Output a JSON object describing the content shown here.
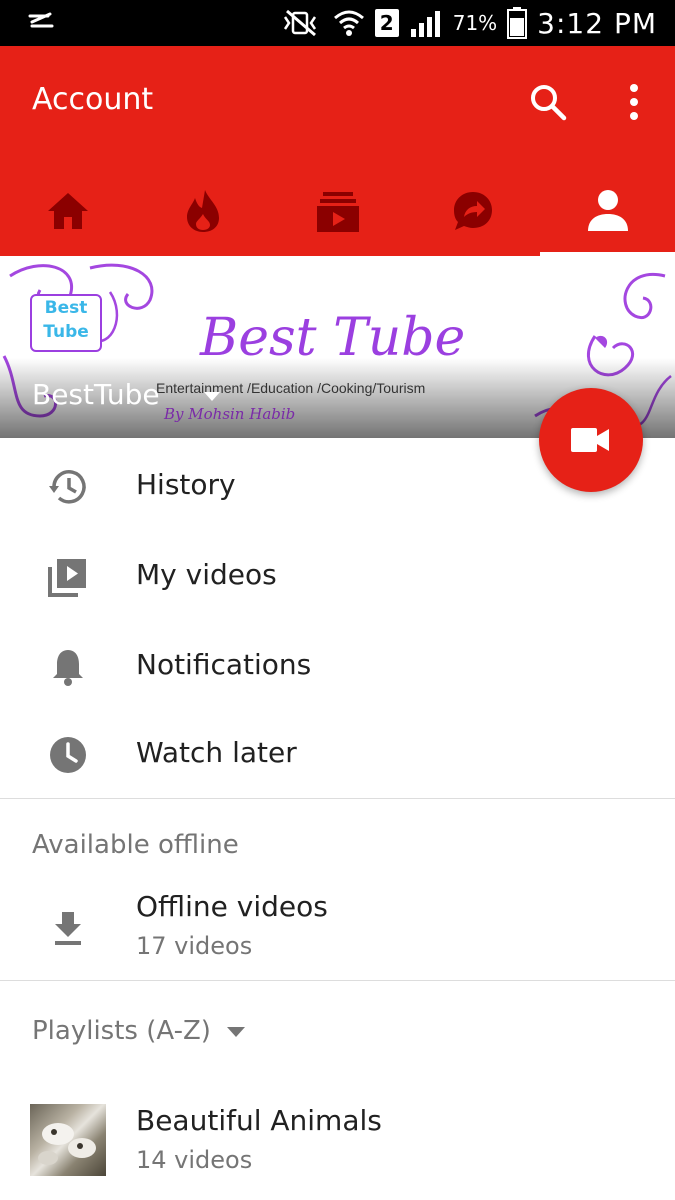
{
  "status_bar": {
    "battery_percent": "71%",
    "time": "3:12 PM",
    "sim_slot": "2"
  },
  "app_bar": {
    "title": "Account",
    "accent_color": "#e62117",
    "tabs": [
      {
        "icon": "home-icon"
      },
      {
        "icon": "trending-icon"
      },
      {
        "icon": "subscriptions-icon"
      },
      {
        "icon": "shared-icon"
      },
      {
        "icon": "account-icon",
        "active": true
      }
    ]
  },
  "banner": {
    "channel_name": "BestTube",
    "logo_line1": "Best",
    "logo_line2": "Tube",
    "title": "Best Tube",
    "subtitle": "Entertainment /Education /Cooking/Tourism",
    "byline": "By Mohsin Habib"
  },
  "menu": [
    {
      "label": "History",
      "icon": "history-icon"
    },
    {
      "label": "My videos",
      "icon": "my-videos-icon"
    },
    {
      "label": "Notifications",
      "icon": "bell-icon"
    },
    {
      "label": "Watch later",
      "icon": "clock-icon"
    }
  ],
  "offline": {
    "section_title": "Available offline",
    "label": "Offline videos",
    "count": "17 videos"
  },
  "playlists": {
    "section_title": "Playlists (A-Z)",
    "items": [
      {
        "title": "Beautiful Animals",
        "count": "14 videos"
      }
    ]
  }
}
